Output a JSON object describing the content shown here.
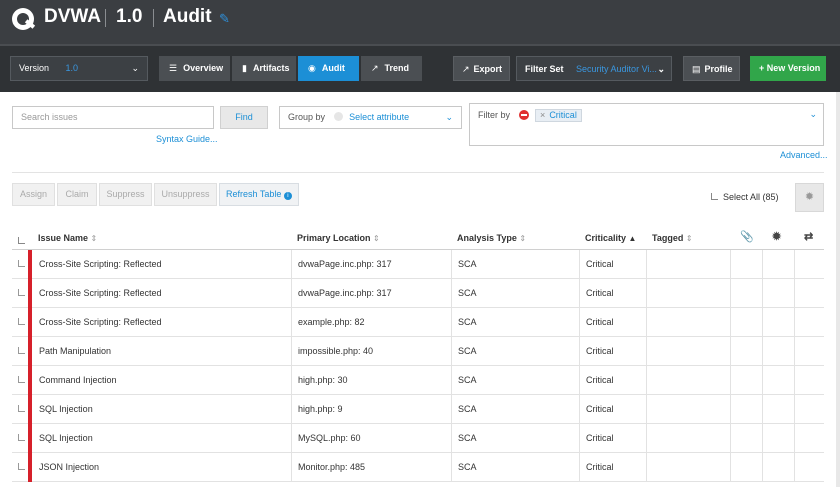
{
  "header": {
    "app_name": "DVWA",
    "version_label": "1.0",
    "page_name": "Audit"
  },
  "toolbar": {
    "version_field_label": "Version",
    "version_value": "1.0",
    "tabs": [
      {
        "label": "Overview",
        "icon": "overview-icon"
      },
      {
        "label": "Artifacts",
        "icon": "book-icon"
      },
      {
        "label": "Audit",
        "icon": "audit-icon",
        "active": true
      },
      {
        "label": "Trend",
        "icon": "trend-icon"
      }
    ],
    "export_label": "Export",
    "filter_set_label": "Filter Set",
    "filter_set_value": "Security Auditor Vi...",
    "profile_label": "Profile",
    "new_version_label": "+ New Version"
  },
  "search": {
    "placeholder": "Search issues",
    "find_label": "Find",
    "syntax_guide_label": "Syntax Guide..."
  },
  "group_by": {
    "label": "Group by",
    "placeholder": "Select attribute"
  },
  "filter_by": {
    "label": "Filter by",
    "tags": [
      "Critical"
    ],
    "advanced_label": "Advanced..."
  },
  "actions": {
    "assign": "Assign",
    "claim": "Claim",
    "suppress": "Suppress",
    "unsuppress": "Unsuppress",
    "refresh": "Refresh Table",
    "select_all": "Select All (85)"
  },
  "table": {
    "columns": {
      "issue_name": "Issue Name",
      "primary_location": "Primary Location",
      "analysis_type": "Analysis Type",
      "criticality": "Criticality",
      "tagged": "Tagged"
    },
    "rows": [
      {
        "issue": "Cross-Site Scripting: Reflected",
        "location": "dvwaPage.inc.php: 317",
        "type": "SCA",
        "criticality": "Critical"
      },
      {
        "issue": "Cross-Site Scripting: Reflected",
        "location": "dvwaPage.inc.php: 317",
        "type": "SCA",
        "criticality": "Critical"
      },
      {
        "issue": "Cross-Site Scripting: Reflected",
        "location": "example.php: 82",
        "type": "SCA",
        "criticality": "Critical"
      },
      {
        "issue": "Path Manipulation",
        "location": "impossible.php: 40",
        "type": "SCA",
        "criticality": "Critical"
      },
      {
        "issue": "Command Injection",
        "location": "high.php: 30",
        "type": "SCA",
        "criticality": "Critical"
      },
      {
        "issue": "SQL Injection",
        "location": "high.php: 9",
        "type": "SCA",
        "criticality": "Critical"
      },
      {
        "issue": "SQL Injection",
        "location": "MySQL.php: 60",
        "type": "SCA",
        "criticality": "Critical"
      },
      {
        "issue": "JSON Injection",
        "location": "Monitor.php: 485",
        "type": "SCA",
        "criticality": "Critical"
      }
    ]
  },
  "colors": {
    "accent": "#1c8fd6",
    "critical": "#d6202a",
    "new_version": "#31a64a",
    "header_bg": "#3b3e42"
  }
}
